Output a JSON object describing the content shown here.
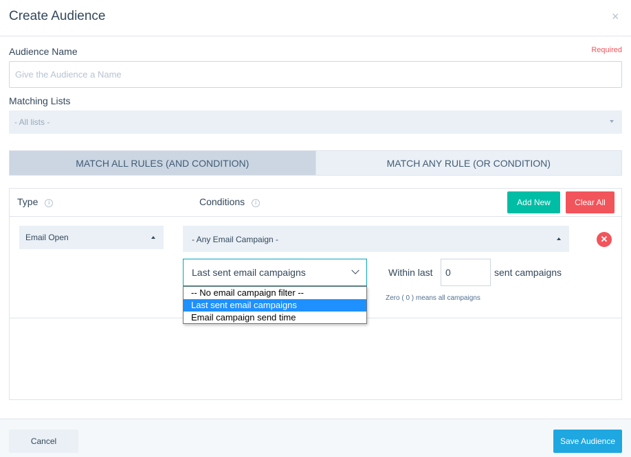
{
  "dialog": {
    "title": "Create Audience",
    "close_glyph": "×"
  },
  "audience_name": {
    "label": "Audience Name",
    "required_text": "Required",
    "placeholder": "Give the Audience a Name",
    "value": ""
  },
  "matching_lists": {
    "label": "Matching Lists",
    "selected": "- All lists -"
  },
  "match_tabs": [
    {
      "label": "MATCH ALL RULES (AND CONDITION)",
      "active": true
    },
    {
      "label": "MATCH ANY RULE (OR CONDITION)",
      "active": false
    }
  ],
  "rules": {
    "type_header": "Type",
    "conditions_header": "Conditions",
    "info_glyph": "i",
    "add_new_label": "Add New",
    "clear_all_label": "Clear All",
    "row": {
      "type_selected": "Email Open",
      "condition_selected": "- Any Email Campaign -",
      "campaign_filter_selected": "Last sent email campaigns",
      "within_label": "Within last",
      "within_value": "0",
      "sent_label": "sent campaigns",
      "hint": "Zero ( 0 ) means all campaigns",
      "remove_glyph": "✕"
    },
    "campaign_filter_options": [
      "-- No email campaign filter --",
      "Last sent email campaigns",
      "Email campaign send time"
    ]
  },
  "footer": {
    "cancel_label": "Cancel",
    "save_label": "Save Audience"
  },
  "colors": {
    "accent_teal": "#00bda5",
    "danger": "#f2545b",
    "primary": "#1ea7e1",
    "selected_option": "#1e90ff"
  }
}
